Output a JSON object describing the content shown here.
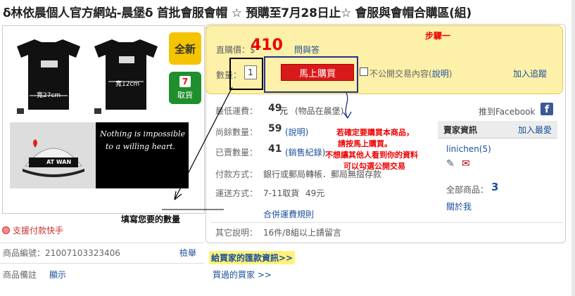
{
  "title": "δ林依晨個人官方網站-晨堡δ 首批會服會帽 ☆ 預購至7月28日止☆ 會服與會帽合購區(組)",
  "badges": {
    "new": "全新",
    "pickup": "取貨"
  },
  "left": {
    "pay_link": "支援付款快手",
    "item_no_label": "商品編號：21007103323406",
    "report": "檢舉",
    "remark_label": "商品備註",
    "remark_value": "顯示"
  },
  "photo": {
    "front_width": "寬27cm",
    "back_width": "寬12cm",
    "slogan1": "Nothing is impossible",
    "slogan2": "to a willing heart.",
    "cap_text": "AT WAN"
  },
  "buy": {
    "price_label": "直購價：$",
    "price": "410",
    "ask": "問與答",
    "qty_label": "數量：",
    "qty_value": "1",
    "buy_button": "馬上購買",
    "private_label": "不公開交易內容",
    "private_link": "說明",
    "add_track": "加入追蹤",
    "step_note": "步驟一"
  },
  "details": {
    "shipping_label": "最低運費：",
    "shipping_value": "49",
    "shipping_unit": "元",
    "shipping_note": "(物品在晨堡)",
    "remain_label": "尚餘數量：",
    "remain_value": "59",
    "remain_link": "(說明)",
    "sold_label": "已賣數量：",
    "sold_value": "41",
    "sold_link": "(銷售紀錄)",
    "payment_label": "付款方式：",
    "payment_value": "銀行或郵局轉帳．郵局無摺存款",
    "delivery_label": "運送方式：",
    "delivery_value": "7-11取貨",
    "delivery_price": "49元",
    "combine_link": "合併運費規則",
    "other_label": "其它說明：",
    "other_value": "16件/8組以上請留言"
  },
  "facebook": "推到Facebook",
  "seller": {
    "header": "賣家資訊",
    "add_fav": "加入最愛",
    "name": "linichen(5)",
    "all_items_label": "全部商品：",
    "all_items_value": "3",
    "about": "關於我"
  },
  "annotations": {
    "buy_hint_1": "若確定要購買本商品，",
    "buy_hint_2": "請按馬上購買。",
    "buy_hint_3": "不想讓其他人看到你的資料",
    "buy_hint_4": "可以勾選公開交易",
    "qty_hint": "填寫您要的數量"
  },
  "footer": {
    "pay_info": "給買家的匯款資訊>>",
    "bought": "買過的買家 >>"
  }
}
